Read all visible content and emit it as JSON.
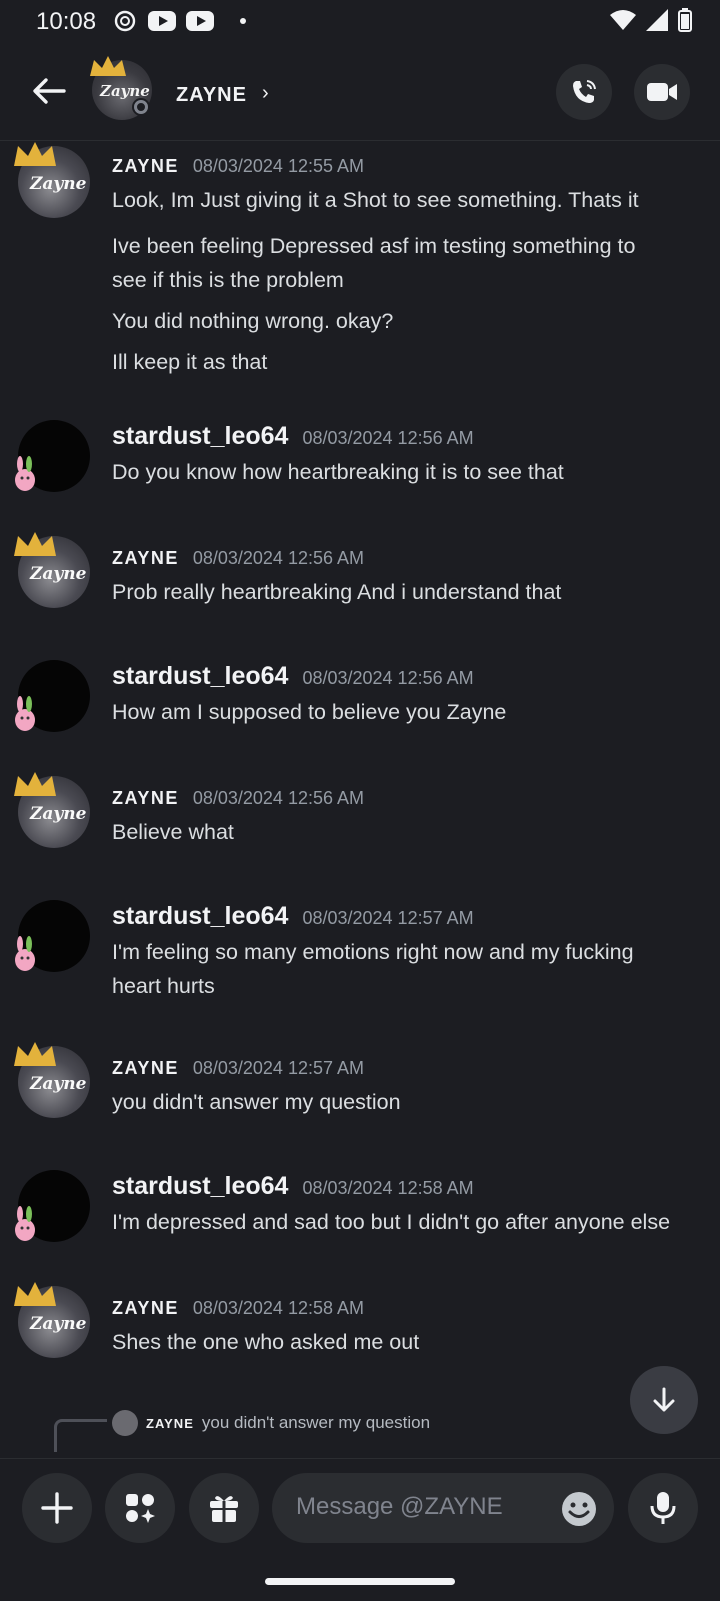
{
  "status_bar": {
    "time": "10:08"
  },
  "header": {
    "title": "ZAYNE",
    "chevron": "›"
  },
  "messages": [
    {
      "author": "ZAYNE",
      "type": "zayne",
      "timestamp": "08/03/2024 12:55 AM",
      "lines": [
        "Look, Im Just giving it a Shot to see something. Thats it",
        "Ive been feeling Depressed asf im testing something to",
        "see if this is the problem",
        "You did nothing wrong. okay?",
        "Ill keep it as that"
      ]
    },
    {
      "author": "stardust_leo64",
      "type": "leo",
      "timestamp": "08/03/2024 12:56 AM",
      "lines": [
        "Do you know how heartbreaking it is to see that"
      ]
    },
    {
      "author": "ZAYNE",
      "type": "zayne",
      "timestamp": "08/03/2024 12:56 AM",
      "lines": [
        "Prob really heartbreaking And i understand  that"
      ]
    },
    {
      "author": "stardust_leo64",
      "type": "leo",
      "timestamp": "08/03/2024 12:56 AM",
      "lines": [
        "How am I supposed to believe you Zayne"
      ]
    },
    {
      "author": "ZAYNE",
      "type": "zayne",
      "timestamp": "08/03/2024 12:56 AM",
      "lines": [
        "Believe what"
      ]
    },
    {
      "author": "stardust_leo64",
      "type": "leo",
      "timestamp": "08/03/2024 12:57 AM",
      "lines": [
        "I'm feeling so many emotions right now and my fucking",
        "heart hurts"
      ]
    },
    {
      "author": "ZAYNE",
      "type": "zayne",
      "timestamp": "08/03/2024 12:57 AM",
      "lines": [
        "you didn't answer my question"
      ]
    },
    {
      "author": "stardust_leo64",
      "type": "leo",
      "timestamp": "08/03/2024 12:58 AM",
      "lines": [
        "I'm depressed and sad too but I didn't go after anyone else"
      ]
    },
    {
      "author": "ZAYNE",
      "type": "zayne",
      "timestamp": "08/03/2024 12:58 AM",
      "lines": [
        "Shes the one who asked me  out"
      ]
    }
  ],
  "reply_preview": {
    "author": "ZAYNE",
    "text": "you didn't answer my question"
  },
  "composer": {
    "placeholder": "Message @ZAYNE"
  },
  "avatar_text": "Zayne",
  "icons": [
    "back-arrow-icon",
    "phone-call-icon",
    "video-camera-icon",
    "plus-icon",
    "apps-icon",
    "gift-icon",
    "emoji-icon",
    "microphone-icon",
    "arrow-down-icon"
  ],
  "colors": {
    "background": "#1c1d22",
    "button_bg": "#2b2d31",
    "timestamp": "#949ba4",
    "text": "#dbdee1"
  }
}
